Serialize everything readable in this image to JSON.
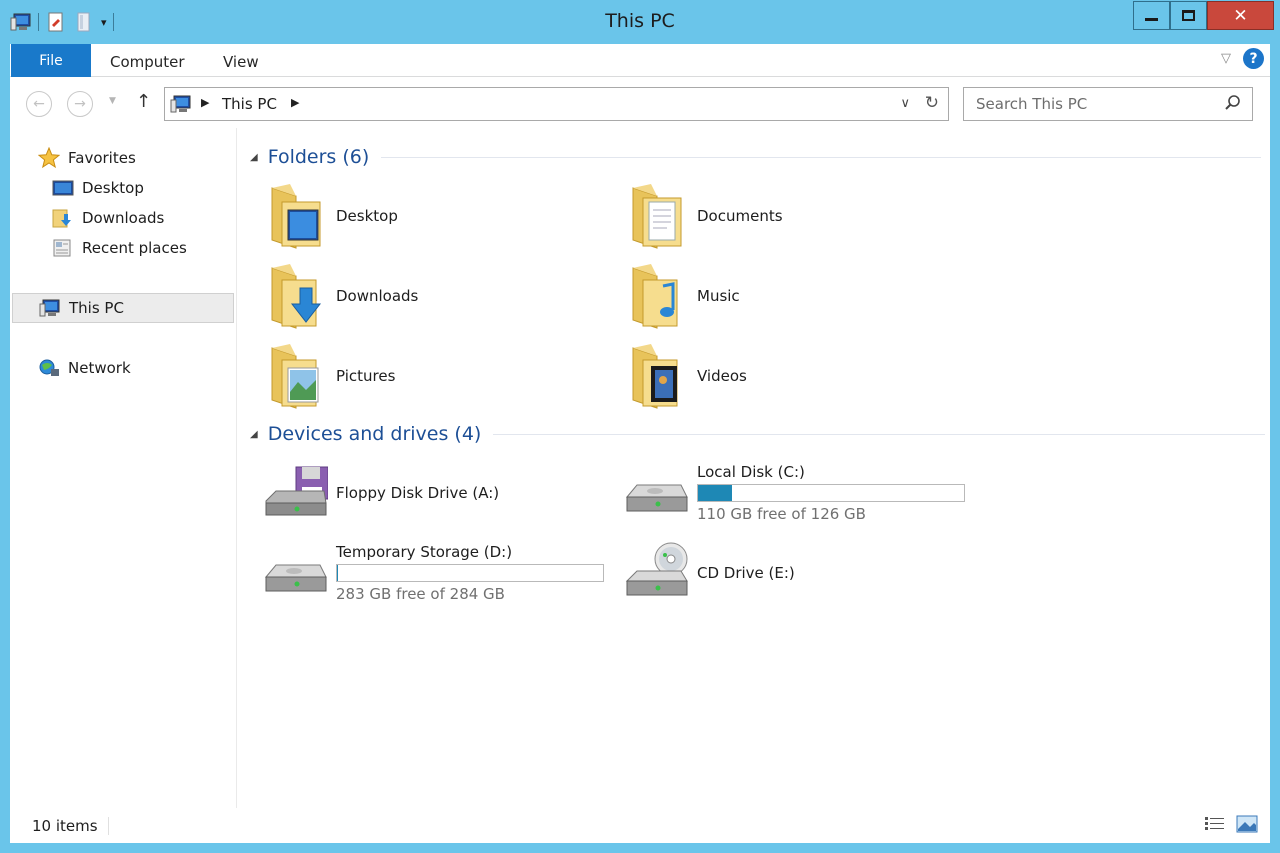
{
  "window": {
    "title": "This PC"
  },
  "ribbon": {
    "file": "File",
    "tabs": [
      "Computer",
      "View"
    ]
  },
  "address": {
    "location": "This PC"
  },
  "search": {
    "placeholder": "Search This PC"
  },
  "navpane": {
    "favorites": "Favorites",
    "favorites_items": [
      "Desktop",
      "Downloads",
      "Recent places"
    ],
    "this_pc": "This PC",
    "network": "Network"
  },
  "folders": {
    "header": "Folders (6)",
    "items": [
      "Desktop",
      "Documents",
      "Downloads",
      "Music",
      "Pictures",
      "Videos"
    ]
  },
  "devices": {
    "header": "Devices and drives (4)",
    "floppy": {
      "label": "Floppy Disk Drive (A:)"
    },
    "local_disk": {
      "label": "Local Disk (C:)",
      "free": "110 GB free of 126 GB",
      "used_fraction": 0.127
    },
    "temp_storage": {
      "label": "Temporary Storage (D:)",
      "free": "283 GB free of 284 GB",
      "used_fraction": 0.004
    },
    "cd_drive": {
      "label": "CD Drive (E:)"
    }
  },
  "status": {
    "items": "10 items"
  },
  "colors": {
    "titlebar": "#6ac5ea",
    "file_tab": "#1979ca",
    "group_header": "#1d4f96",
    "drive_bar": "#1e88b5",
    "close": "#c9483c"
  }
}
